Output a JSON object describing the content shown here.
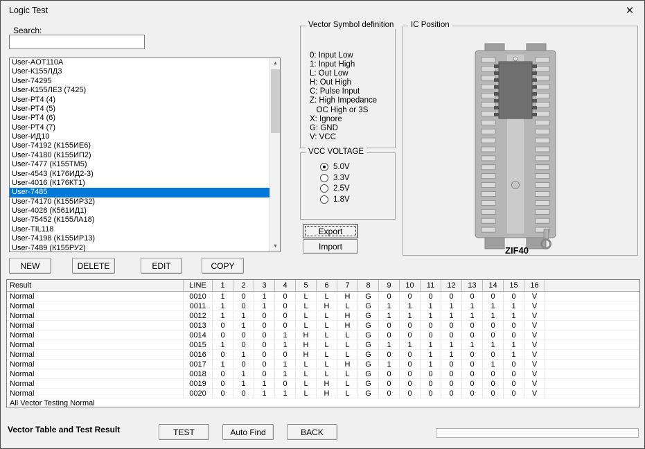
{
  "window": {
    "title": "Logic Test",
    "close_glyph": "✕"
  },
  "search": {
    "label": "Search:",
    "value": ""
  },
  "device_list": {
    "items": [
      "User-AOT110A",
      "User-К155ЛД3",
      "User-74295",
      "User-К155ЛЕ3 (7425)",
      "User-РТ4 (4)",
      "User-РТ4 (5)",
      "User-РТ4 (6)",
      "User-РТ4 (7)",
      "User-ИД10",
      "User-74192 (К155ИЕ6)",
      "User-74180 (К155ИП2)",
      "User-7477 (К155ТМ5)",
      "User-4543 (К176ИД2-3)",
      "User-4016 (К176КТ1)",
      "User-7485",
      "User-74170 (К155ИР32)",
      "User-4028 (К561ИД1)",
      "User-75452 (К155ЛА18)",
      "User-TIL118",
      "User-74198 (К155ИР13)",
      "User-7489 (К155РУ2)"
    ],
    "selected_index": 14,
    "scrollbar": {
      "up": "▲",
      "down": "▼"
    }
  },
  "list_buttons": {
    "new": "NEW",
    "delete": "DELETE",
    "edit": "EDIT",
    "copy": "COPY"
  },
  "vector_symbols": {
    "title": "Vector Symbol definition",
    "lines": [
      "0: Input Low",
      "1: Input High",
      "L: Out Low",
      "H: Out High",
      "C: Pulse Input",
      "Z: High Impedance",
      "   OC High or 3S",
      "X: Ignore",
      "G: GND",
      "V: VCC"
    ]
  },
  "vcc_voltage": {
    "title": "VCC VOLTAGE",
    "options": [
      "5.0V",
      "3.3V",
      "2.5V",
      "1.8V"
    ],
    "selected_index": 0
  },
  "io_buttons": {
    "export": "Export",
    "import": "Import"
  },
  "ic_position": {
    "title": "IC Position",
    "socket_label": "ZIF40"
  },
  "vector_table": {
    "columns": [
      "Result",
      "LINE",
      "1",
      "2",
      "3",
      "4",
      "5",
      "6",
      "7",
      "8",
      "9",
      "10",
      "11",
      "12",
      "13",
      "14",
      "15",
      "16"
    ],
    "rows": [
      {
        "result": "Normal",
        "line": "0010",
        "values": [
          "1",
          "0",
          "1",
          "0",
          "L",
          "L",
          "H",
          "G",
          "0",
          "0",
          "0",
          "0",
          "0",
          "0",
          "0",
          "V"
        ]
      },
      {
        "result": "Normal",
        "line": "0011",
        "values": [
          "1",
          "0",
          "1",
          "0",
          "L",
          "H",
          "L",
          "G",
          "1",
          "1",
          "1",
          "1",
          "1",
          "1",
          "1",
          "V"
        ]
      },
      {
        "result": "Normal",
        "line": "0012",
        "values": [
          "1",
          "1",
          "0",
          "0",
          "L",
          "L",
          "H",
          "G",
          "1",
          "1",
          "1",
          "1",
          "1",
          "1",
          "1",
          "V"
        ]
      },
      {
        "result": "Normal",
        "line": "0013",
        "values": [
          "0",
          "1",
          "0",
          "0",
          "L",
          "L",
          "H",
          "G",
          "0",
          "0",
          "0",
          "0",
          "0",
          "0",
          "0",
          "V"
        ]
      },
      {
        "result": "Normal",
        "line": "0014",
        "values": [
          "0",
          "0",
          "0",
          "1",
          "H",
          "L",
          "L",
          "G",
          "0",
          "0",
          "0",
          "0",
          "0",
          "0",
          "0",
          "V"
        ]
      },
      {
        "result": "Normal",
        "line": "0015",
        "values": [
          "1",
          "0",
          "0",
          "1",
          "H",
          "L",
          "L",
          "G",
          "1",
          "1",
          "1",
          "1",
          "1",
          "1",
          "1",
          "V"
        ]
      },
      {
        "result": "Normal",
        "line": "0016",
        "values": [
          "0",
          "1",
          "0",
          "0",
          "H",
          "L",
          "L",
          "G",
          "0",
          "0",
          "1",
          "1",
          "0",
          "0",
          "1",
          "V"
        ]
      },
      {
        "result": "Normal",
        "line": "0017",
        "values": [
          "1",
          "0",
          "0",
          "1",
          "L",
          "L",
          "H",
          "G",
          "1",
          "0",
          "1",
          "0",
          "0",
          "1",
          "0",
          "V"
        ]
      },
      {
        "result": "Normal",
        "line": "0018",
        "values": [
          "0",
          "1",
          "0",
          "1",
          "L",
          "L",
          "L",
          "G",
          "0",
          "0",
          "0",
          "0",
          "0",
          "0",
          "0",
          "V"
        ]
      },
      {
        "result": "Normal",
        "line": "0019",
        "values": [
          "0",
          "1",
          "1",
          "0",
          "L",
          "H",
          "L",
          "G",
          "0",
          "0",
          "0",
          "0",
          "0",
          "0",
          "0",
          "V"
        ]
      },
      {
        "result": "Normal",
        "line": "0020",
        "values": [
          "0",
          "0",
          "1",
          "1",
          "L",
          "H",
          "L",
          "G",
          "0",
          "0",
          "0",
          "0",
          "0",
          "0",
          "0",
          "V"
        ]
      }
    ],
    "footer": "All Vector Testing Normal"
  },
  "bottom_bar": {
    "status_label": "Vector Table and Test Result",
    "test": "TEST",
    "auto_find": "Auto Find",
    "back": "BACK"
  },
  "colors": {
    "selection": "#0078d7",
    "window_bg": "#f0f0f0"
  }
}
